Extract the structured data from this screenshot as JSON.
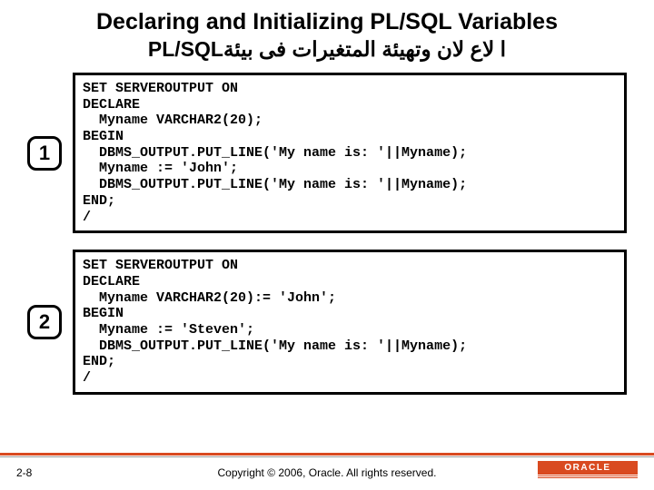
{
  "title": "Declaring and Initializing PL/SQL Variables",
  "subtitle": "ا       لاع     لان وتهيئة المتغيرات فى بيئةPL/SQL",
  "examples": [
    {
      "num": "1",
      "code": "SET SERVEROUTPUT ON\nDECLARE\n  Myname VARCHAR2(20);\nBEGIN\n  DBMS_OUTPUT.PUT_LINE('My name is: '||Myname);\n  Myname := 'John';\n  DBMS_OUTPUT.PUT_LINE('My name is: '||Myname);\nEND;\n/"
    },
    {
      "num": "2",
      "code": "SET SERVEROUTPUT ON\nDECLARE\n  Myname VARCHAR2(20):= 'John';\nBEGIN\n  Myname := 'Steven';\n  DBMS_OUTPUT.PUT_LINE('My name is: '||Myname);\nEND;\n/"
    }
  ],
  "page_number": "2-8",
  "copyright": "Copyright © 2006, Oracle. All rights reserved.",
  "logo_text": "ORACLE"
}
